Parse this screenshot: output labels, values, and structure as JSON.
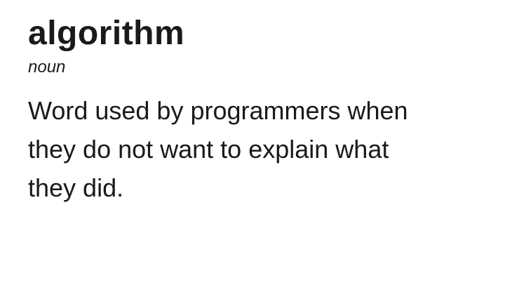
{
  "entry": {
    "headword": "algorithm",
    "part_of_speech": "noun",
    "definition_lines": [
      "Word used by programmers when",
      "they do not want to explain what",
      "they did."
    ]
  }
}
